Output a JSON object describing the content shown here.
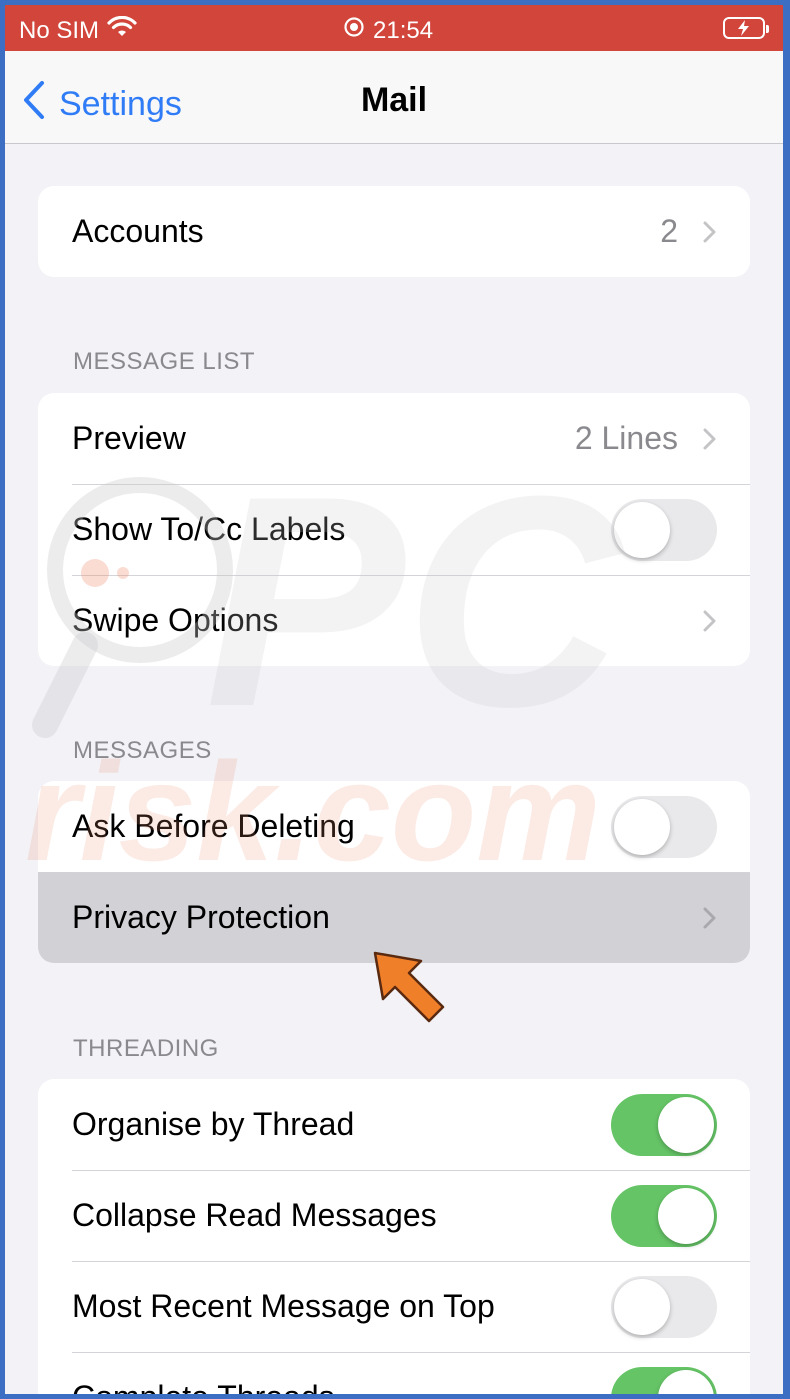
{
  "status_bar": {
    "carrier": "No SIM",
    "time": "21:54",
    "icons": [
      "wifi-icon",
      "orientation-lock-icon",
      "battery-charging-icon"
    ]
  },
  "nav": {
    "back_label": "Settings",
    "title": "Mail"
  },
  "accounts": {
    "label": "Accounts",
    "value": "2"
  },
  "message_list": {
    "header": "MESSAGE LIST",
    "preview": {
      "label": "Preview",
      "value": "2 Lines"
    },
    "show_to_cc": {
      "label": "Show To/Cc Labels",
      "on": false
    },
    "swipe_options": {
      "label": "Swipe Options"
    }
  },
  "messages": {
    "header": "MESSAGES",
    "ask_before_deleting": {
      "label": "Ask Before Deleting",
      "on": false
    },
    "privacy_protection": {
      "label": "Privacy Protection"
    }
  },
  "threading": {
    "header": "THREADING",
    "organise_by_thread": {
      "label": "Organise by Thread",
      "on": true
    },
    "collapse_read": {
      "label": "Collapse Read Messages",
      "on": true
    },
    "most_recent_top": {
      "label": "Most Recent Message on Top",
      "on": false
    },
    "complete_threads": {
      "label": "Complete Threads",
      "on": true
    }
  },
  "watermark": "PCrisk.com",
  "colors": {
    "status_bar": "#d1453b",
    "accent": "#2f7cf6",
    "toggle_on": "#65c466",
    "arrow": "#f07f2a",
    "frame": "#3c6fc4"
  }
}
